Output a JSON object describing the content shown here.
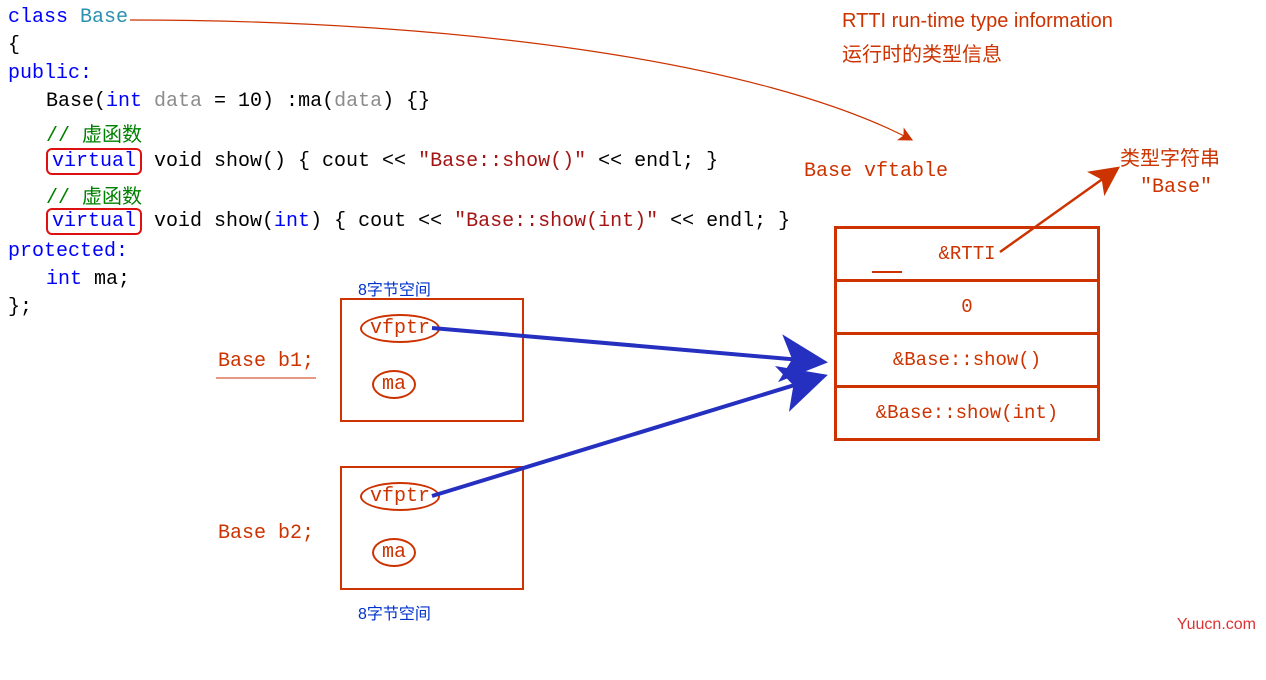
{
  "code": {
    "class_kw": "class",
    "class_name": "Base",
    "brace_open": "{",
    "public_kw": "public:",
    "ctor_pre": "Base(",
    "ctor_int": "int",
    "ctor_param": " data",
    "ctor_default": " = 10) :ma(",
    "ctor_arg": "data",
    "ctor_end": ") {}",
    "comment1": "// 虚函数",
    "virtual1": "virtual",
    "show1_sig": " void show() { cout << ",
    "show1_str": "\"Base::show()\"",
    "show1_end": " << endl; }",
    "comment2": "// 虚函数",
    "virtual2": "virtual",
    "show2_sig": " void show(",
    "show2_type": "int",
    "show2_sig2": ") { cout << ",
    "show2_str": "\"Base::show(int)\"",
    "show2_end": " << endl; }",
    "protected_kw": "protected:",
    "member_type": "int",
    "member_name": " ma;",
    "brace_close": "};"
  },
  "labels": {
    "eight_byte_top": "8字节空间",
    "eight_byte_bottom": "8字节空间",
    "base_b1": "Base b1;",
    "base_b2": "Base b2;",
    "vfptr": "vfptr",
    "ma": "ma",
    "vftable_title": "Base vftable",
    "rtti_title1": "RTTI run-time type information",
    "rtti_title2": "运行时的类型信息",
    "type_string_label": "类型字符串",
    "type_string_value": "\"Base\""
  },
  "vftable": {
    "row0": "&RTTI",
    "row1": "0",
    "row2": "&Base::show()",
    "row3": "&Base::show(int)"
  },
  "watermark": "Yuucn.com"
}
